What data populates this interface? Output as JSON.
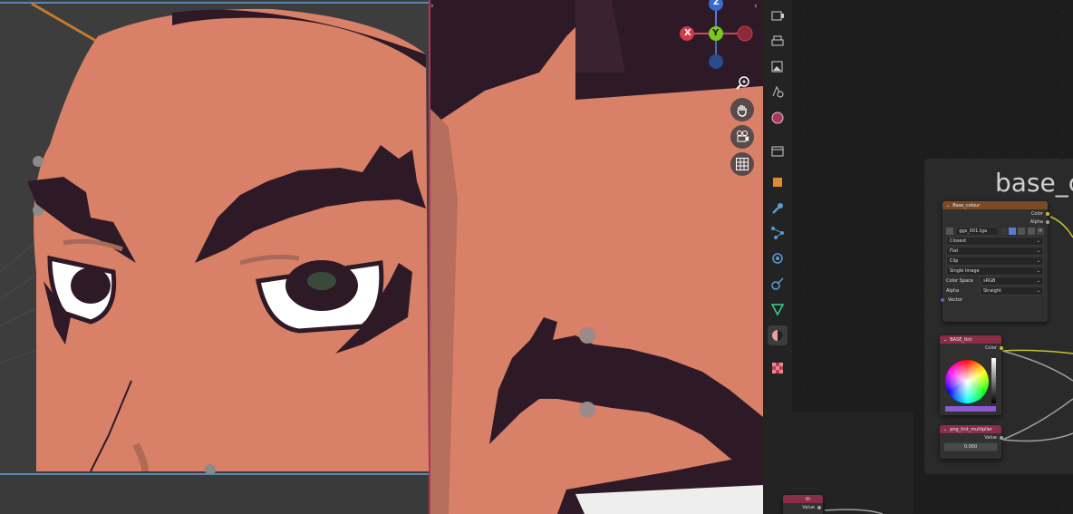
{
  "gizmo": {
    "z": "Z",
    "x": "X",
    "y": "Y"
  },
  "frame_title": "base_c",
  "nodes": {
    "base_colour": {
      "title": "Base_colour",
      "out_color": "Color",
      "out_alpha": "Alpha",
      "image_name": "ggs_001.tga",
      "interpolation": "Closest",
      "projection": "Flat",
      "extension": "Clip",
      "source": "Single Image",
      "color_space_label": "Color Space",
      "color_space_value": "sRGB",
      "alpha_label": "Alpha",
      "alpha_value": "Straight",
      "in_vector": "Vector"
    },
    "base_tint": {
      "title": "BASE_tint",
      "out_color": "Color"
    },
    "tint_multiplier": {
      "title": "png_tint_multiplier",
      "out_value": "Value",
      "value": "0.000"
    },
    "bottom_node": {
      "title": "th",
      "out_value": "Value"
    }
  },
  "colors": {
    "viewport_bg": "#3d3d3d",
    "skin": "#d98069",
    "hair": "#2e1a26",
    "divider": "#b53357",
    "node_orange": "#7a4a24",
    "node_pink": "#8a2d48",
    "link_yellow": "#c7c12e",
    "link_gray": "#a0a0a0"
  }
}
